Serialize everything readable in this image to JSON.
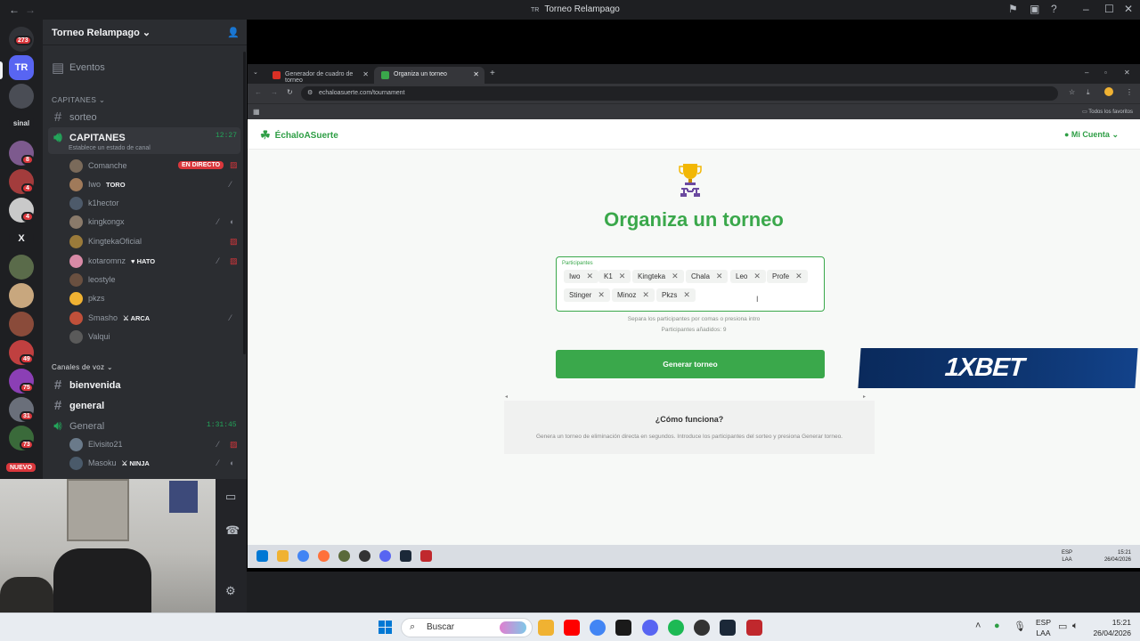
{
  "window": {
    "title": "Torneo Relampago",
    "title_icon": "TR"
  },
  "server": {
    "name": "Torneo Relampago",
    "events_label": "Eventos",
    "rail": [
      {
        "label": "",
        "badge": "273"
      },
      {
        "label": "TR",
        "badge": ""
      },
      {
        "label": "",
        "badge": ""
      },
      {
        "label": "sinal",
        "badge": ""
      },
      {
        "label": "",
        "badge": "8"
      },
      {
        "label": "",
        "badge": "4"
      },
      {
        "label": "",
        "badge": "4"
      },
      {
        "label": "X",
        "badge": ""
      },
      {
        "label": "",
        "badge": ""
      },
      {
        "label": "",
        "badge": ""
      },
      {
        "label": "",
        "badge": ""
      },
      {
        "label": "",
        "badge": "49"
      },
      {
        "label": "",
        "badge": "75"
      },
      {
        "label": "",
        "badge": "31"
      },
      {
        "label": "",
        "badge": "73"
      }
    ],
    "new_label": "NUEVO"
  },
  "channels": {
    "cat_captains": "CAPITANES",
    "sorteo": "sorteo",
    "voice_active": {
      "name": "CAPITANES",
      "time": "12:27",
      "status": "Establece un estado de canal"
    },
    "users": [
      {
        "name": "Comanche",
        "tag": ""
      },
      {
        "name": "Iwo",
        "tag": "TORO"
      },
      {
        "name": "k1hector",
        "tag": ""
      },
      {
        "name": "kingkongx",
        "tag": ""
      },
      {
        "name": "KingtekaOficial",
        "tag": ""
      },
      {
        "name": "kotaromnz",
        "tag": "HATO"
      },
      {
        "name": "leostyle",
        "tag": ""
      },
      {
        "name": "pkzs",
        "tag": ""
      },
      {
        "name": "Smasho",
        "tag": "ARCA"
      },
      {
        "name": "Valqui",
        "tag": ""
      }
    ],
    "live_label": "EN DIRECTO",
    "cat_voice": "Canales de voz",
    "bienvenida": "bienvenida",
    "general_text": "general",
    "general_voice": {
      "name": "General",
      "time": "1:31:45"
    },
    "voice_users": [
      {
        "name": "Elvisito21",
        "tag": ""
      },
      {
        "name": "Masoku",
        "tag": "NINJA"
      }
    ]
  },
  "browser": {
    "tabs": [
      {
        "label": "Generador de cuadro de torneo",
        "active": false
      },
      {
        "label": "Organiza un torneo",
        "active": true
      }
    ],
    "url": "echaloasuerte.com/tournament",
    "bookmarks": "Todos los favoritos"
  },
  "site": {
    "logo": "ÉchaloASuerte",
    "account": "Mi Cuenta",
    "title": "Organiza un torneo",
    "field_label": "Participantes",
    "participants": [
      "Iwo",
      "K1",
      "Kingteka",
      "Chala",
      "Leo",
      "Profe",
      "Stinger",
      "Minoz",
      "Pkzs"
    ],
    "hint1": "Separa los participantes por comas o presiona intro",
    "hint2": "Participantes añadidos: 9",
    "button": "Generar torneo",
    "how_title": "¿Cómo funciona?",
    "how_text": "Genera un torneo de eliminación directa en segundos. Introduce los participantes del sorteo y presiona Generar torneo."
  },
  "ad": {
    "text": "1XBET"
  },
  "inner_taskbar": {
    "lang1": "ESP",
    "lang2": "LAA",
    "time": "15:21",
    "date": "26/04/2026"
  },
  "taskbar": {
    "search": "Buscar",
    "lang1": "ESP",
    "lang2": "LAA",
    "time": "15:21",
    "date": "26/04/2026"
  },
  "colors": {
    "accent_green": "#3aa84b",
    "discord_bg": "#2b2d31",
    "live_red": "#da373c",
    "blurple": "#5865f2"
  }
}
